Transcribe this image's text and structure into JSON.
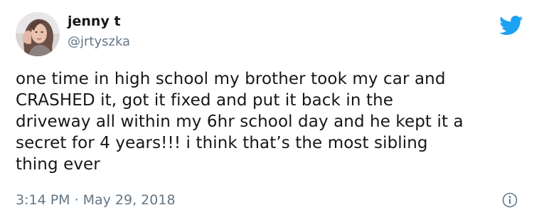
{
  "author": {
    "display_name": "jenny t",
    "handle": "@jrtyszka",
    "avatar_icon": "profile-photo"
  },
  "tweet": {
    "lines": [
      "one time in high school my brother took my car and",
      "CRASHED it, got it fixed and put it back in the",
      "driveway all within my 6hr school day and he kept it a",
      "secret for 4 years!!! i think that’s the most sibling",
      "thing ever"
    ],
    "time": "3:14 PM",
    "separator": "·",
    "date": "May 29, 2018"
  },
  "icons": {
    "brand": "twitter-bird-icon",
    "info": "info-icon"
  },
  "colors": {
    "brand": "#1da1f2",
    "text": "#14171a",
    "muted": "#657786"
  }
}
